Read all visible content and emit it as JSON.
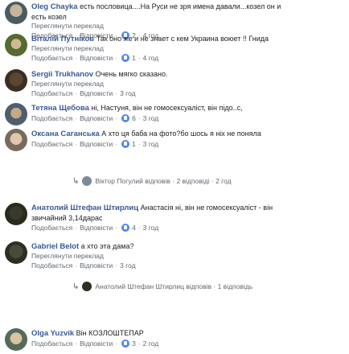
{
  "comments": [
    {
      "name": "Oleg Chayka",
      "text_line1": "есть пословица....На Руси не зря имена давали...козел он и",
      "text_line2": "есть козел",
      "translate": "Переглянути переклад",
      "like": "Подобається",
      "reply": "Відповісти",
      "count": "2",
      "time": "4 год"
    },
    {
      "name": "Віталій Путніков",
      "text_line1": "Так оно же и не знает с кем Украина воюет !! Гнида",
      "translate": "Переглянути переклад",
      "like": "Подобається",
      "reply": "Відповісти",
      "count": "1",
      "time": "4 год"
    },
    {
      "name": "Sergii Trukhanov",
      "text_line1": "Очень мягко сказано.",
      "translate": "Переглянути переклад",
      "like": "Подобається",
      "reply": "Відповісти",
      "time": "3 год"
    },
    {
      "name": "Тетяна Щебова",
      "text_line1": "ні, Настуня, він не гомосексуаліст, він підо..с,",
      "like": "Подобається",
      "reply": "Відповісти",
      "count": "6",
      "time": "3 год"
    },
    {
      "name": "Оксана Саганська",
      "text_line1": "А хто ця баба на фото?бо шось я ніх не поняла",
      "like": "Подобається",
      "reply": "Відповісти",
      "count": "1",
      "time": "3 год",
      "replies": {
        "author": "Віктор Погулий",
        "verb": "відповів",
        "dot": "·",
        "count_text": "2 відповіді",
        "time": "2 год"
      }
    },
    {
      "name": "Анатолий Штефан Штирлиц",
      "text_line1": "Анастасія ні, він не гомосексуаліст - він",
      "text_line2": "звичайний 3,14дарас",
      "like": "Подобається",
      "reply": "Відповісти",
      "count": "4",
      "time": "3 год"
    },
    {
      "name": "Gabriel Belot",
      "text_line1": "а хто эта дама?",
      "translate": "Переглянути переклад",
      "like": "Подобається",
      "reply": "Відповісти",
      "time": "3 год",
      "replies": {
        "author": "Анатолий Штефан Штирлиц",
        "verb": "відповів",
        "dot": "·",
        "count_text": "1 відповідь"
      }
    },
    {
      "name": "Olga Yuzvik",
      "text_line1": "Він КОЗЛОШТЕПАР",
      "like": "Подобається",
      "reply": "Відповісти",
      "count": "3",
      "time": "2 год"
    }
  ]
}
